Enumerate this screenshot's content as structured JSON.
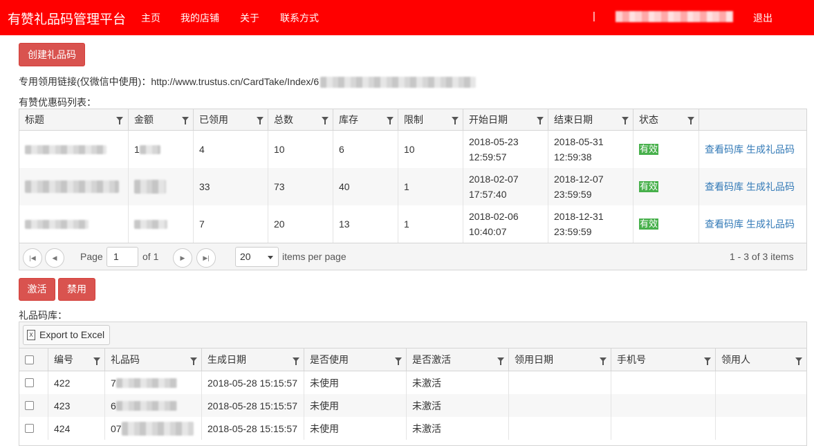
{
  "nav": {
    "brand": "有赞礼品码管理平台",
    "links": [
      "主页",
      "我的店铺",
      "关于",
      "联系方式"
    ],
    "separator": "|",
    "logout": "退出"
  },
  "create_button": "创建礼品码",
  "link_line": "专用领用链接(仅微信中使用)：http://www.trustus.cn/CardTake/Index/6",
  "list_title": "有赞优惠码列表：",
  "grid1": {
    "columns": [
      "标题",
      "金额",
      "已领用",
      "总数",
      "库存",
      "限制",
      "开始日期",
      "结束日期",
      "状态",
      ""
    ],
    "rows": [
      {
        "amount": "1",
        "taken": "4",
        "total": "10",
        "stock": "6",
        "limit": "10",
        "start": [
          "2018-05-23",
          "12:59:57"
        ],
        "end": [
          "2018-05-31",
          "12:59:38"
        ],
        "status": "有效"
      },
      {
        "amount": "",
        "taken": "33",
        "total": "73",
        "stock": "40",
        "limit": "1",
        "start": [
          "2018-02-07",
          "17:57:40"
        ],
        "end": [
          "2018-12-07",
          "23:59:59"
        ],
        "status": "有效"
      },
      {
        "amount": "",
        "taken": "7",
        "total": "20",
        "stock": "13",
        "limit": "1",
        "start": [
          "2018-02-06",
          "10:40:07"
        ],
        "end": [
          "2018-12-31",
          "23:59:59"
        ],
        "status": "有效"
      }
    ],
    "action_view": "查看码库",
    "action_generate": "生成礼品码",
    "status_color": "#47b04b"
  },
  "pager": {
    "page_label": "Page",
    "page_value": "1",
    "of_label": "of 1",
    "per_page_value": "20",
    "per_page_label": "items per page",
    "summary": "1 - 3 of 3 items",
    "icons": [
      "first-page-icon",
      "prev-page-icon",
      "next-page-icon",
      "last-page-icon"
    ]
  },
  "activate_button": "激活",
  "disable_button": "禁用",
  "library_title": "礼品码库：",
  "grid2": {
    "export_label": "Export to Excel",
    "columns": [
      "编号",
      "礼品码",
      "生成日期",
      "是否使用",
      "是否激活",
      "领用日期",
      "手机号",
      "领用人"
    ],
    "rows": [
      {
        "id": "422",
        "code": "7",
        "date": "2018-05-28 15:15:57",
        "used": "未使用",
        "active": "未激活"
      },
      {
        "id": "423",
        "code": "6",
        "date": "2018-05-28 15:15:57",
        "used": "未使用",
        "active": "未激活"
      },
      {
        "id": "424",
        "code": "07",
        "date": "2018-05-28 15:15:57",
        "used": "未使用",
        "active": "未激活"
      }
    ]
  },
  "colors": {
    "navbar": "#ff0000",
    "danger": "#d9534f",
    "link": "#337ab7"
  }
}
